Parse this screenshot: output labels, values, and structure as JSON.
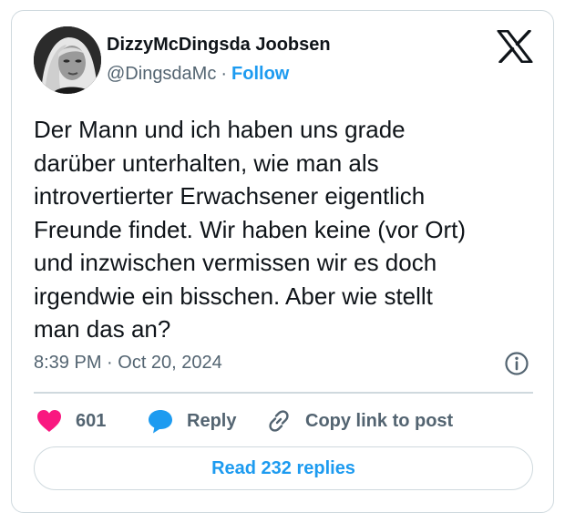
{
  "author": {
    "display_name": "DizzyMcDingsda Joobsen",
    "handle": "@DingsdaMc",
    "separator": "·",
    "follow_label": "Follow",
    "avatar_icon": "profile-photo"
  },
  "platform": {
    "logo_icon": "x-logo-icon"
  },
  "tweet": {
    "text": "Der Mann und ich haben uns grade\ndarüber unterhalten, wie man als\nintrovertierter Erwachsener eigentlich\nFreunde findet. Wir haben keine (vor Ort)\nund inzwischen vermissen wir es doch\nirgendwie ein bisschen. Aber wie stellt\nman das an?",
    "timestamp": "8:39 PM · Oct 20, 2024",
    "info_icon": "info-icon"
  },
  "actions": {
    "like_count": "601",
    "like_icon": "heart-icon",
    "reply_label": "Reply",
    "reply_icon": "speech-bubble-icon",
    "copy_label": "Copy link to post",
    "copy_icon": "link-icon"
  },
  "footer": {
    "read_replies_label": "Read 232 replies"
  },
  "colors": {
    "accent": "#1d9bf0",
    "like": "#f91880",
    "text": "#0f1419",
    "muted": "#536471",
    "border": "#cfd9de"
  }
}
